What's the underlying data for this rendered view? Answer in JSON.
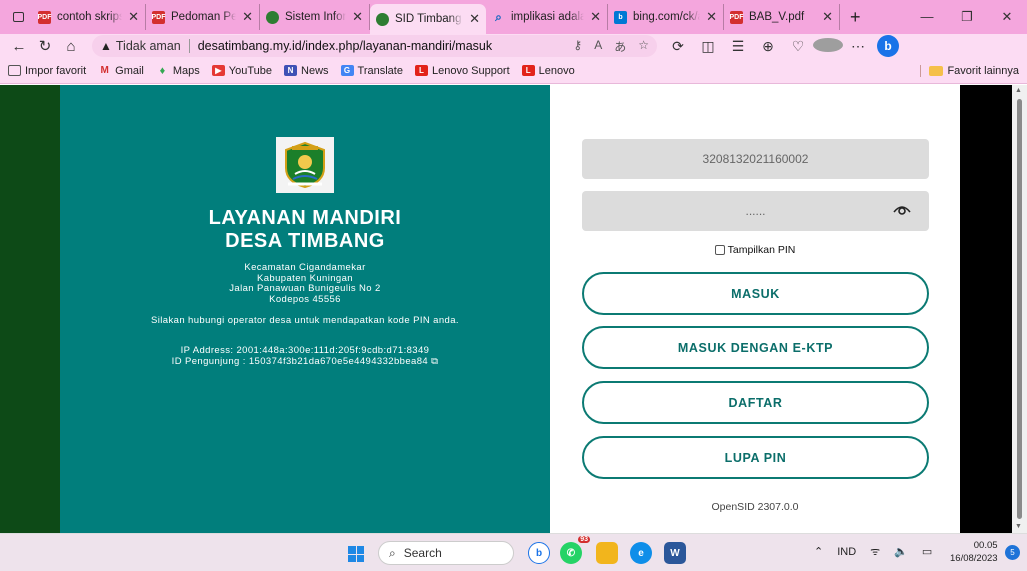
{
  "browser": {
    "tabs": [
      {
        "title": "contoh skripsi s",
        "icon": "pdf-icon"
      },
      {
        "title": "Pedoman Penu",
        "icon": "pdf-icon"
      },
      {
        "title": "Sistem Informa",
        "icon": "sid-icon"
      },
      {
        "title": "SID Timbang D",
        "icon": "sid-icon",
        "active": true
      },
      {
        "title": "implikasi adalah",
        "icon": "search-icon"
      },
      {
        "title": "bing.com/ck/a",
        "icon": "bing-icon"
      },
      {
        "title": "BAB_V.pdf",
        "icon": "pdf-icon"
      }
    ],
    "address": {
      "security_label": "Tidak aman",
      "url": "desatimbang.my.id/index.php/layanan-mandiri/masuk"
    },
    "bookmarks": [
      {
        "label": "Impor favorit",
        "icon": "import-icon"
      },
      {
        "label": "Gmail",
        "icon": "gmail-icon"
      },
      {
        "label": "Maps",
        "icon": "maps-icon"
      },
      {
        "label": "YouTube",
        "icon": "youtube-icon"
      },
      {
        "label": "News",
        "icon": "news-icon"
      },
      {
        "label": "Translate",
        "icon": "translate-icon"
      },
      {
        "label": "Lenovo Support",
        "icon": "lenovo-icon"
      },
      {
        "label": "Lenovo",
        "icon": "lenovo-icon"
      }
    ],
    "bookmarks_folder": "Favorit lainnya"
  },
  "brand": {
    "title_line1": "LAYANAN MANDIRI",
    "title_line2": "DESA TIMBANG",
    "address_lines": [
      "Kecamatan Cigandamekar",
      "Kabupaten Kuningan",
      "Jalan Panawuan Bunigeulis No 2",
      "Kodepos 45556"
    ],
    "hint": "Silakan hubungi operator desa untuk mendapatkan kode PIN anda.",
    "ip_address": "IP Address: 2001:448a:300e:111d:205f:9cdb:d71:8349",
    "visitor_id": "ID Pengunjung : 150374f3b21da670e5e4494332bbea84"
  },
  "form": {
    "nik_value": "3208132021160002",
    "pin_value": "......",
    "show_pin_label": "Tampilkan PIN",
    "buttons": {
      "login": "MASUK",
      "login_ektp": "MASUK DENGAN E-KTP",
      "register": "DAFTAR",
      "forgot": "LUPA PIN"
    },
    "version": "OpenSID 2307.0.0"
  },
  "taskbar": {
    "search_label": "Search",
    "whatsapp_badge": "93",
    "language": "IND",
    "time": "00.05",
    "date": "16/08/2023",
    "notifications": "5"
  },
  "colors": {
    "teal": "#017e7c",
    "dark_green": "#0d4a17",
    "button_border": "#0b7a73",
    "browser_pink": "#fcdcf3"
  }
}
